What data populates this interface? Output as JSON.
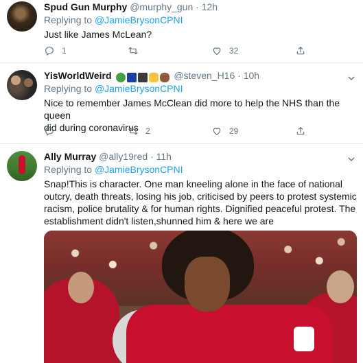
{
  "tweets": [
    {
      "name": "Spud Gun Murphy",
      "handle": "@murphy_gun",
      "dot": "·",
      "time": "12h",
      "reply_prefix": "Replying to ",
      "reply_to": "@JamieBrysonCPNI",
      "text": "Just like James McLean?",
      "counts": {
        "reply": "1",
        "retweet": "",
        "like": "32"
      }
    },
    {
      "name": "YisWorldWeird",
      "emoji_icons": [
        "shamrock-icon",
        "eu-flag-icon",
        "movie-camera-icon",
        "rock-hand-icon",
        "raised-fist-icon"
      ],
      "handle": "@steven_H16",
      "dot": "·",
      "time": "10h",
      "reply_prefix": "Replying to ",
      "reply_to": "@JamieBrysonCPNI",
      "text_lines": [
        "Nice to remember James McClean did more to help the NHS than the queen",
        "did during coronavirus"
      ],
      "counts": {
        "reply": "",
        "retweet": "2",
        "like": "29"
      }
    },
    {
      "name": "Ally Murray",
      "handle": "@ally19red",
      "dot": "·",
      "time": "11h",
      "reply_prefix": "Replying to ",
      "reply_to": "@JamieBrysonCPNI",
      "text_lines": [
        "Snap!This is character. One man kneeling alone in the face of national",
        "outcry, death threats, losing his job, criticised by peers to protest systemic",
        "racism, police brutality & for human rights. Dignified peaceful protest. The",
        "establishment didn't listen,shunned him & here we are"
      ]
    }
  ],
  "colors": {
    "link": "#1da1f2",
    "secondary_text": "#657786",
    "primary_text": "#14171a",
    "divider": "#e6ecf0"
  }
}
